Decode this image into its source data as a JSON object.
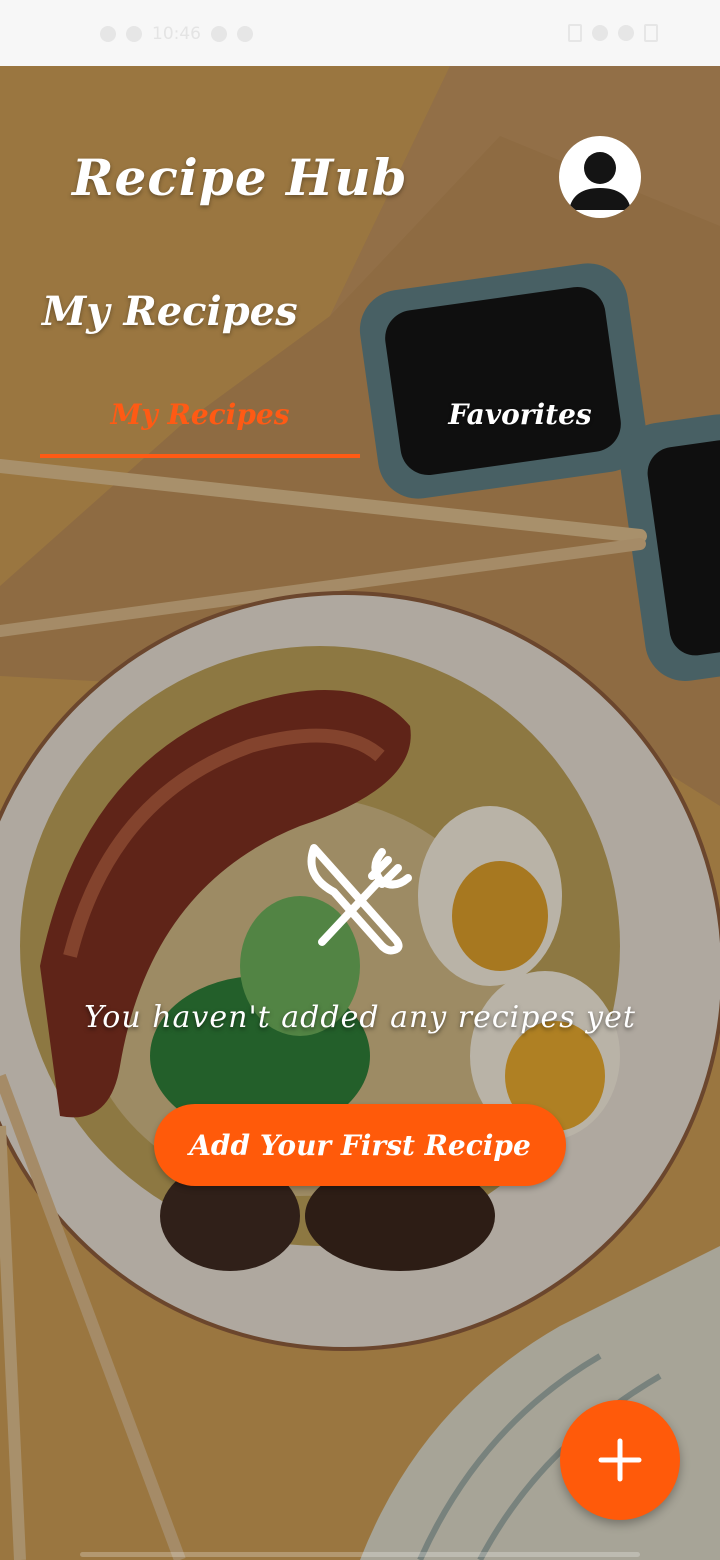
{
  "status_bar": {
    "time": "10:46",
    "left_icons": [
      "signal-icon",
      "wifi-icon",
      "alarm-icon",
      "settings-icon"
    ],
    "right_icons": [
      "notification-icon",
      "location-icon",
      "vibrate-icon",
      "battery-icon"
    ]
  },
  "header": {
    "app_title": "Recipe Hub",
    "profile_icon": "person-icon"
  },
  "section": {
    "title": "My Recipes"
  },
  "tabs": [
    {
      "label": "My Recipes",
      "selected": true
    },
    {
      "label": "Favorites",
      "selected": false
    }
  ],
  "empty_state": {
    "icon": "cutlery-icon",
    "message": "You haven't added any recipes yet",
    "button_label": "Add Your First Recipe"
  },
  "fab": {
    "icon": "plus-icon"
  },
  "colors": {
    "accent": "#ff5a0a",
    "text": "#ffffff",
    "status_bar_bg": "#f7f7f7"
  }
}
